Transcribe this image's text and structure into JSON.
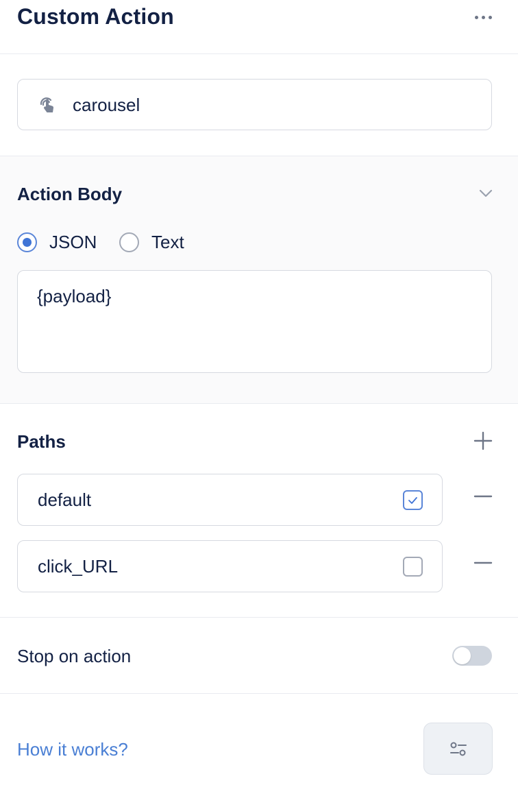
{
  "header": {
    "title": "Custom Action",
    "more_icon": "more-horizontal-icon"
  },
  "action": {
    "name": "carousel",
    "icon": "touch-gesture-icon"
  },
  "action_body": {
    "title": "Action Body",
    "collapse_icon": "chevron-down-icon",
    "format_options": [
      {
        "label": "JSON",
        "selected": true
      },
      {
        "label": "Text",
        "selected": false
      }
    ],
    "content": "{payload}"
  },
  "paths": {
    "title": "Paths",
    "add_icon": "plus-icon",
    "items": [
      {
        "name": "default",
        "checked": true
      },
      {
        "name": "click_URL",
        "checked": false
      }
    ]
  },
  "stop_on_action": {
    "label": "Stop on action",
    "enabled": false
  },
  "footer": {
    "help_link": "How it works?",
    "settings_icon": "sliders-icon"
  },
  "colors": {
    "accent": "#3f74d6",
    "link": "#4a7fd4",
    "text": "#132144"
  }
}
